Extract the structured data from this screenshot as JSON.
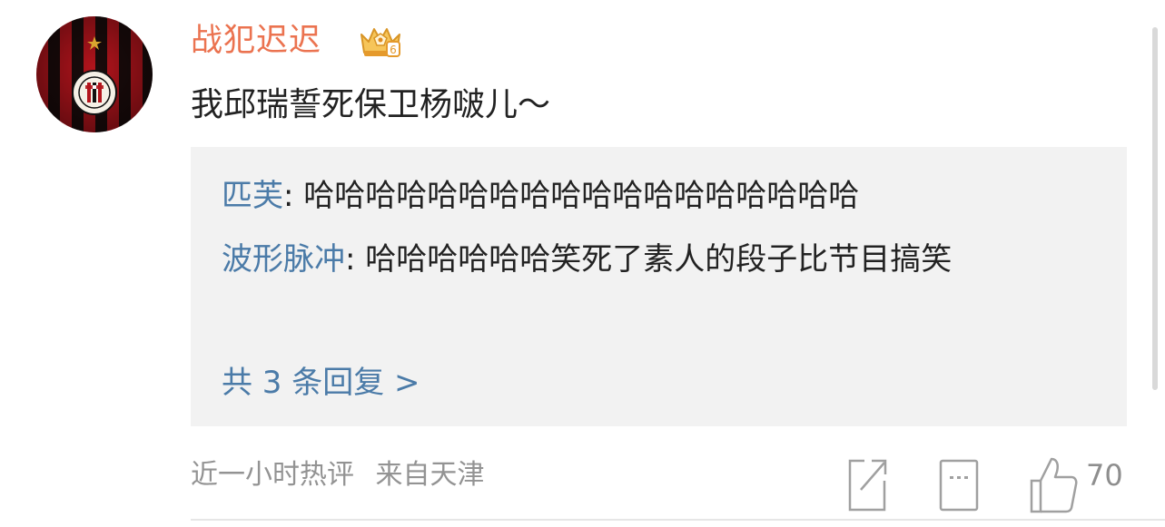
{
  "comment": {
    "username": "战犯迟迟",
    "text": "我邱瑞誓死保卫杨啵儿～",
    "replies": [
      {
        "name": "匹芙",
        "sep": ": ",
        "text": "哈哈哈哈哈哈哈哈哈哈哈哈哈哈哈哈哈哈"
      },
      {
        "name": "波形脉冲",
        "sep": ": ",
        "text": "哈哈哈哈哈哈笑死了素人的段子比节目搞笑"
      }
    ],
    "more_replies": "共 3 条回复 >",
    "time": "近一小时热评",
    "location": "来自天津",
    "likes": "70"
  },
  "icons": {
    "avatar": "ac-milan-logo-avatar",
    "badge": "vip-crown-badge-icon",
    "share": "share-icon",
    "comment": "comment-icon",
    "like": "thumbs-up-icon"
  },
  "colors": {
    "username": "#eb7350",
    "reply_name": "#4b7ba8",
    "reply_bg": "#f2f2f2",
    "meta": "#939393",
    "text": "#222222"
  }
}
